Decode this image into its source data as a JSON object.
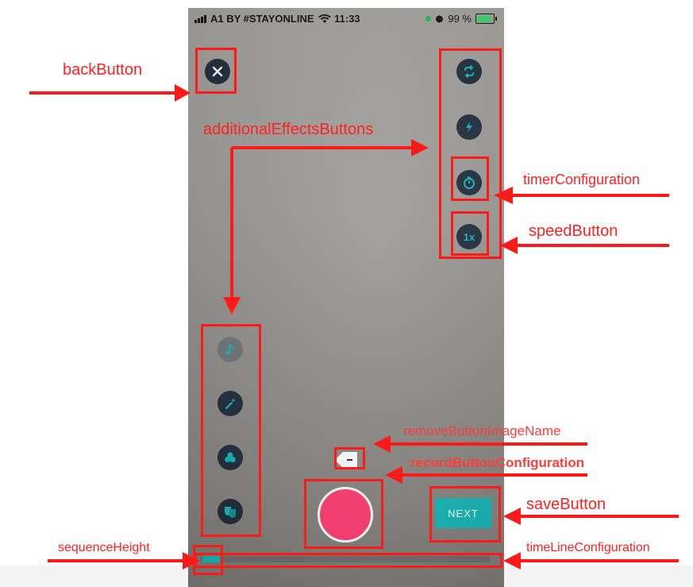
{
  "status_bar": {
    "carrier": "A1 BY #STAYONLINE",
    "time": "11:33",
    "battery": "99 %"
  },
  "controls": {
    "next_label": "NEXT"
  },
  "annotations": {
    "back_button": "backButton",
    "additional_effects": "additionalEffectsButtons",
    "timer_configuration": "timerConfiguration",
    "speed_button": "speedButton",
    "remove_button_image_name": "removeButtonImageName",
    "record_button_configuration": "recordButtonConfiguration",
    "save_button": "saveButton",
    "sequence_height": "sequenceHeight",
    "timeline_configuration": "timeLineConfiguration"
  },
  "icons": {
    "back": "close-icon",
    "switch_camera": "switch-camera-icon",
    "flash": "flash-icon",
    "timer": "timer-icon",
    "speed": "1x",
    "music": "music-note-icon",
    "magic": "magic-wand-icon",
    "filters": "filters-icon",
    "masks": "masks-icon"
  },
  "colors": {
    "accent": "#13b5b5",
    "record": "#ff3a6e",
    "annotation": "#ff1a1a",
    "button_bg": "#1d2b3a"
  }
}
